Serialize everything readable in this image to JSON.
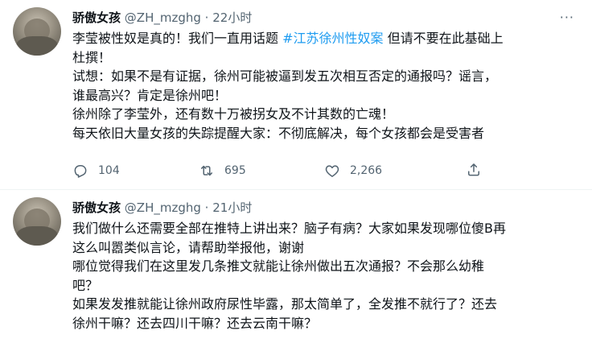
{
  "tweets": [
    {
      "name": "骄傲女孩",
      "handle": "@ZH_mzghg",
      "dot": "·",
      "time": "22小时",
      "more": "···",
      "lines": [
        {
          "pre": "李莹被性奴是真的！我们一直用话题 ",
          "tag": "#江苏徐州性奴案",
          "post": " 但请不要在此基础上"
        },
        {
          "pre": "杜撰！"
        },
        {
          "pre": "试想：如果不是有证据，徐州可能被逼到发五次相互否定的通报吗？谣言，"
        },
        {
          "pre": "谁最高兴？肯定是徐州吧！"
        },
        {
          "pre": "徐州除了李莹外，还有数十万被拐女及不计其数的亡魂！"
        },
        {
          "pre": "每天依旧大量女孩的失踪提醒大家：不彻底解决，每个女孩都会是受害者"
        }
      ],
      "replies": "104",
      "retweets": "695",
      "likes": "2,266"
    },
    {
      "name": "骄傲女孩",
      "handle": "@ZH_mzghg",
      "dot": "·",
      "time": "21小时",
      "lines": [
        {
          "pre": "我们做什么还需要全部在推特上讲出来？脑子有病？大家如果发现哪位傻B再"
        },
        {
          "pre": "这么叫嚣类似言论，请帮助举报他，谢谢"
        },
        {
          "pre": "哪位觉得我们在这里发几条推文就能让徐州做出五次通报？不会那么幼稚"
        },
        {
          "pre": "吧？"
        },
        {
          "pre": "如果发发推就能让徐州政府尿性毕露，那太简单了，全发推不就行了？还去"
        },
        {
          "pre": "徐州干嘛？还去四川干嘛？还去云南干嘛？"
        }
      ]
    }
  ]
}
